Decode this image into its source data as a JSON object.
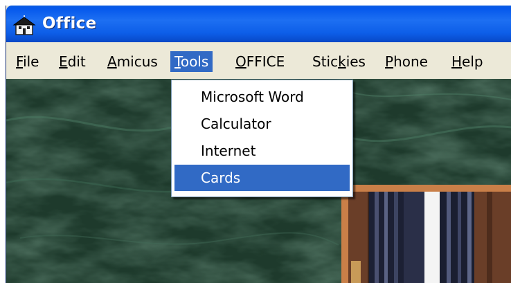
{
  "window": {
    "title": "Office",
    "icon": "office-building-icon"
  },
  "menu": {
    "items": [
      {
        "label": "File",
        "accel": "F"
      },
      {
        "label": "Edit",
        "accel": "E"
      },
      {
        "label": "Amicus",
        "accel": "A"
      },
      {
        "label": "Tools",
        "accel": "T",
        "active": true
      },
      {
        "label": "OFFICE",
        "accel": "O"
      },
      {
        "label": "Stickies",
        "accel": "k"
      },
      {
        "label": "Phone",
        "accel": "P"
      },
      {
        "label": "Help",
        "accel": "H"
      }
    ]
  },
  "tools_menu": {
    "items": [
      {
        "label": "Microsoft Word"
      },
      {
        "label": "Calculator"
      },
      {
        "label": "Internet"
      },
      {
        "label": "Cards",
        "selected": true
      }
    ]
  },
  "colors": {
    "titlebar": "#0d5ee8",
    "menu_highlight": "#316ac5",
    "desktop": "#1d3b2c",
    "picture_frame": "#c97f48"
  }
}
